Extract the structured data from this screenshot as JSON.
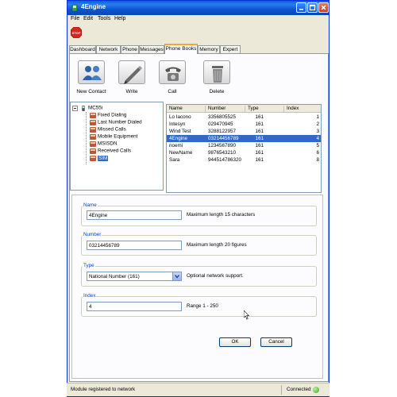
{
  "window": {
    "title": "4Engine"
  },
  "menu": [
    "File",
    "Edit",
    "Tools",
    "Help"
  ],
  "tabs": [
    "Dashboard",
    "Network",
    "Phone",
    "Messages",
    "Phone Books",
    "Memory",
    "Expert"
  ],
  "active_tab": "Phone Books",
  "toolbar": {
    "new_contact": "New Contact",
    "write": "Write",
    "call": "Call",
    "delete": "Delete"
  },
  "tree": {
    "root": "MC55i",
    "items": [
      "Fixed Dialing",
      "Last Number Dialed",
      "Missed Calls",
      "Mobile Equipment",
      "MSISDN",
      "Received Calls",
      "SIM"
    ],
    "selected": "SIM"
  },
  "table": {
    "headers": [
      "Name",
      "Number",
      "Type",
      "Index"
    ],
    "rows": [
      [
        "Lo Iacono",
        "3356805525",
        "161",
        "1"
      ],
      [
        "Intesyn",
        "029470945",
        "161",
        "2"
      ],
      [
        "Wind Test",
        "3288122957",
        "161",
        "3"
      ],
      [
        "4Engine",
        "03214456789",
        "161",
        "4"
      ],
      [
        "noemi",
        "1234567890",
        "161",
        "5"
      ],
      [
        "NewName",
        "9876543210",
        "161",
        "6"
      ],
      [
        "Sara",
        "944514786320",
        "161",
        "8"
      ]
    ],
    "selected_index": 3
  },
  "form": {
    "name": {
      "label": "Name",
      "value": "4Engine",
      "hint": "Maximum length 15 characters"
    },
    "number": {
      "label": "Number",
      "value": "03214456789",
      "hint": "Maximum length 20 figures"
    },
    "type": {
      "label": "Type",
      "value": "National Number (161)",
      "hint": "Optional network support."
    },
    "index": {
      "label": "Index",
      "value": "4",
      "hint": "Range 1 - 250"
    },
    "ok": "OK",
    "cancel": "Cancel"
  },
  "status": {
    "message": "Module registered to network",
    "connection": "Connected"
  },
  "colors": {
    "accent": "#316ac5",
    "titlebar": "#0a5ed7",
    "connected": "#3aa62a"
  }
}
